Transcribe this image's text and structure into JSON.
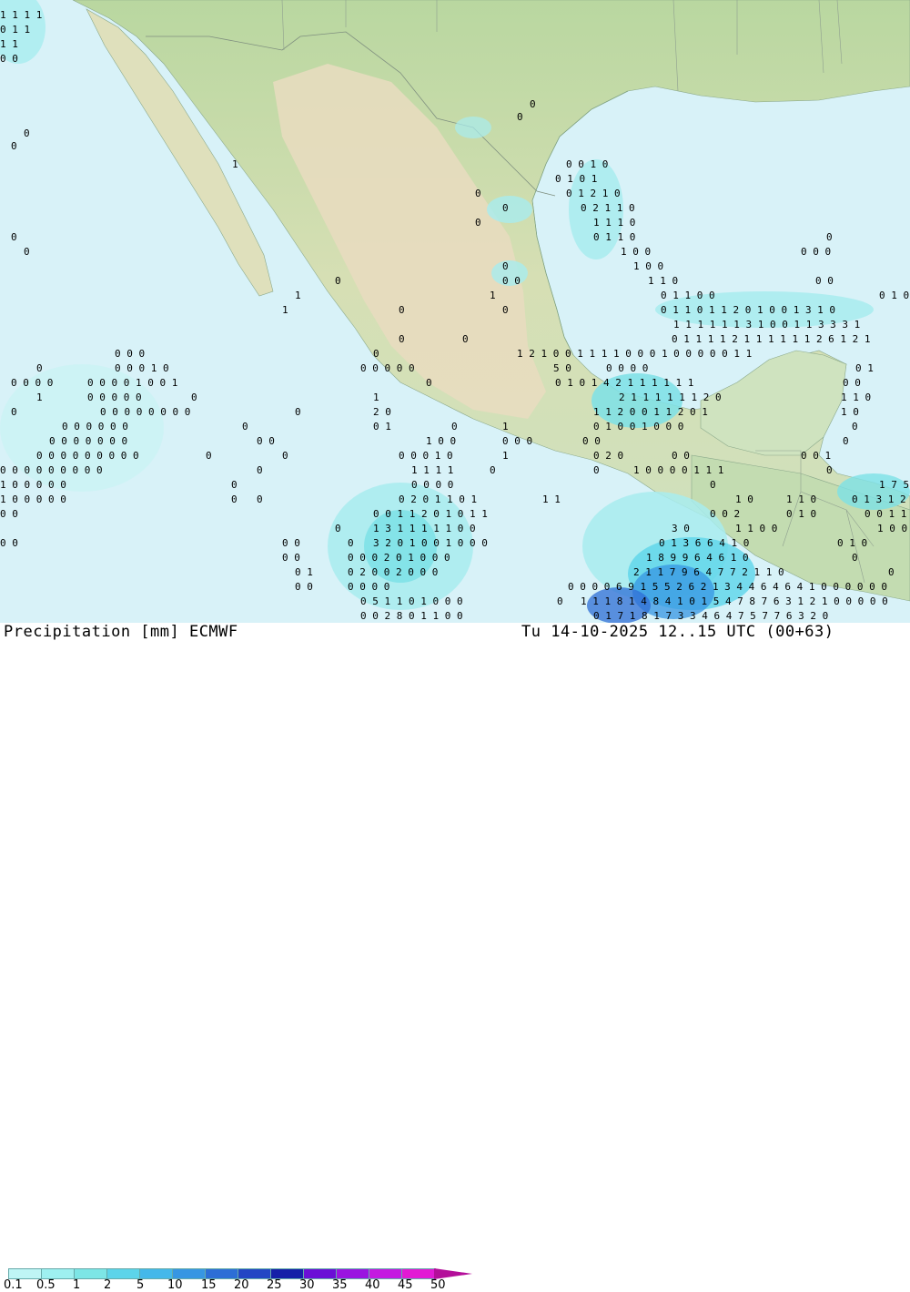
{
  "title": {
    "left": "Precipitation [mm] ECMWF",
    "right": "Tu 14-10-2025 12..15 UTC (00+63)"
  },
  "legend": {
    "ticks": [
      "0.1",
      "0.5",
      "1",
      "2",
      "5",
      "10",
      "15",
      "20",
      "25",
      "30",
      "35",
      "40",
      "45",
      "50"
    ],
    "colors": [
      "#bff5f5",
      "#9ef0f0",
      "#7de6e6",
      "#5cd4ea",
      "#44b8ea",
      "#3796e3",
      "#2d6ed6",
      "#2346c4",
      "#1520a8",
      "#6b0fd6",
      "#9a14e0",
      "#c41ae0",
      "#e21ad4",
      "#b40f9a"
    ]
  },
  "map": {
    "ocean_color": "#d8f2f8",
    "land_color": "#cfe3bf",
    "plateau_color": "#e8dcc0"
  }
}
